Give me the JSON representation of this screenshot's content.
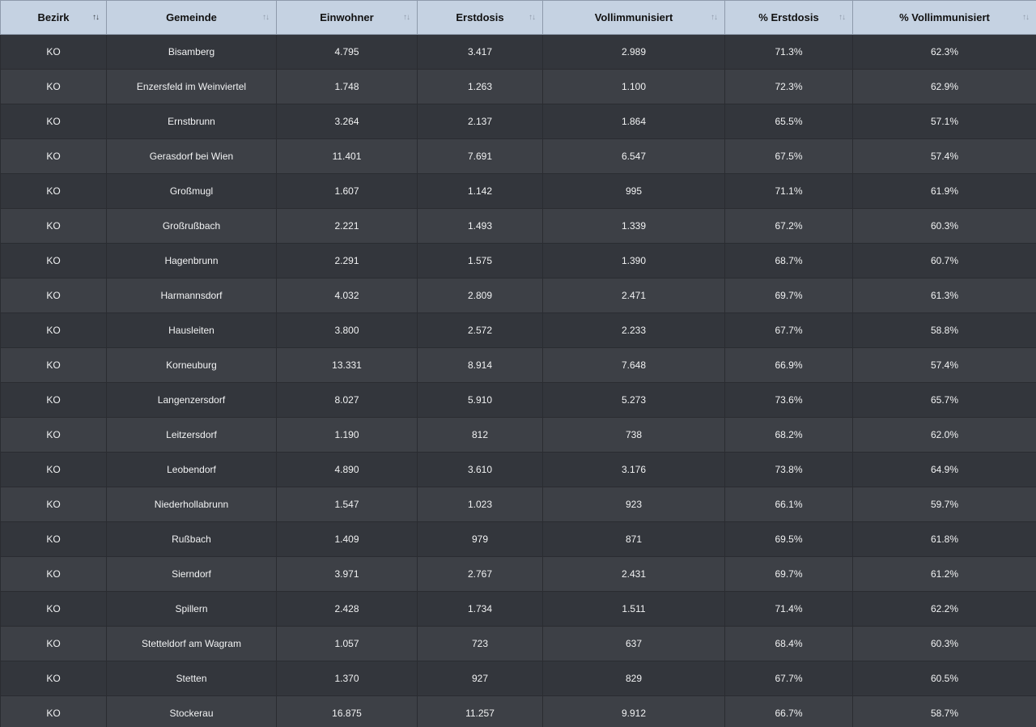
{
  "headers": [
    {
      "label": "Bezirk",
      "sort": "asc"
    },
    {
      "label": "Gemeinde",
      "sort": "none"
    },
    {
      "label": "Einwohner",
      "sort": "none"
    },
    {
      "label": "Erstdosis",
      "sort": "none"
    },
    {
      "label": "Vollimmunisiert",
      "sort": "none"
    },
    {
      "label": "% Erstdosis",
      "sort": "none"
    },
    {
      "label": "% Vollimmunisiert",
      "sort": "none"
    }
  ],
  "sort_glyphs": {
    "none": "↑↓",
    "asc": "↑↓"
  },
  "rows": [
    [
      "KO",
      "Bisamberg",
      "4.795",
      "3.417",
      "2.989",
      "71.3%",
      "62.3%"
    ],
    [
      "KO",
      "Enzersfeld im Weinviertel",
      "1.748",
      "1.263",
      "1.100",
      "72.3%",
      "62.9%"
    ],
    [
      "KO",
      "Ernstbrunn",
      "3.264",
      "2.137",
      "1.864",
      "65.5%",
      "57.1%"
    ],
    [
      "KO",
      "Gerasdorf bei Wien",
      "11.401",
      "7.691",
      "6.547",
      "67.5%",
      "57.4%"
    ],
    [
      "KO",
      "Großmugl",
      "1.607",
      "1.142",
      "995",
      "71.1%",
      "61.9%"
    ],
    [
      "KO",
      "Großrußbach",
      "2.221",
      "1.493",
      "1.339",
      "67.2%",
      "60.3%"
    ],
    [
      "KO",
      "Hagenbrunn",
      "2.291",
      "1.575",
      "1.390",
      "68.7%",
      "60.7%"
    ],
    [
      "KO",
      "Harmannsdorf",
      "4.032",
      "2.809",
      "2.471",
      "69.7%",
      "61.3%"
    ],
    [
      "KO",
      "Hausleiten",
      "3.800",
      "2.572",
      "2.233",
      "67.7%",
      "58.8%"
    ],
    [
      "KO",
      "Korneuburg",
      "13.331",
      "8.914",
      "7.648",
      "66.9%",
      "57.4%"
    ],
    [
      "KO",
      "Langenzersdorf",
      "8.027",
      "5.910",
      "5.273",
      "73.6%",
      "65.7%"
    ],
    [
      "KO",
      "Leitzersdorf",
      "1.190",
      "812",
      "738",
      "68.2%",
      "62.0%"
    ],
    [
      "KO",
      "Leobendorf",
      "4.890",
      "3.610",
      "3.176",
      "73.8%",
      "64.9%"
    ],
    [
      "KO",
      "Niederhollabrunn",
      "1.547",
      "1.023",
      "923",
      "66.1%",
      "59.7%"
    ],
    [
      "KO",
      "Rußbach",
      "1.409",
      "979",
      "871",
      "69.5%",
      "61.8%"
    ],
    [
      "KO",
      "Sierndorf",
      "3.971",
      "2.767",
      "2.431",
      "69.7%",
      "61.2%"
    ],
    [
      "KO",
      "Spillern",
      "2.428",
      "1.734",
      "1.511",
      "71.4%",
      "62.2%"
    ],
    [
      "KO",
      "Stetteldorf am Wagram",
      "1.057",
      "723",
      "637",
      "68.4%",
      "60.3%"
    ],
    [
      "KO",
      "Stetten",
      "1.370",
      "927",
      "829",
      "67.7%",
      "60.5%"
    ],
    [
      "KO",
      "Stockerau",
      "16.875",
      "11.257",
      "9.912",
      "66.7%",
      "58.7%"
    ]
  ]
}
